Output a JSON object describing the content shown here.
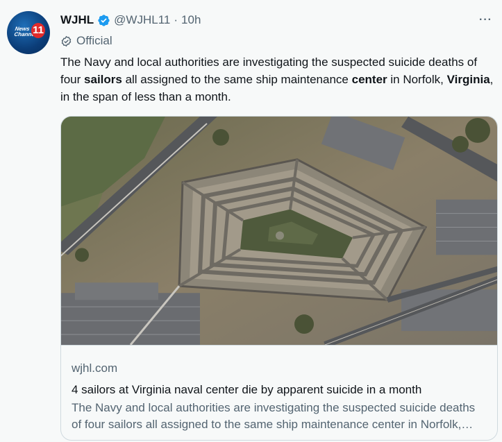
{
  "tweet": {
    "avatar_icon": "news-channel-11-logo",
    "avatar_text_small": "News Channel",
    "avatar_text_number": "11",
    "display_name": "WJHL",
    "handle": "@WJHL11",
    "separator": "·",
    "time": "10h",
    "verified_icon": "verified-badge-icon",
    "official_label": "Official",
    "official_icon": "checkmark-circle-icon",
    "more_icon": "more-horizontal-icon",
    "text_parts": {
      "p1": "The Navy and local authorities are investigating the suspected suicide deaths of four ",
      "b1": "sailors",
      "p2": " all assigned to the same ship maintenance ",
      "b2": "center",
      "p3": " in Norfolk, ",
      "b3": "Virginia",
      "p4": ", in the span of less than a month."
    }
  },
  "card": {
    "image_description": "pentagon-aerial-photo",
    "domain": "wjhl.com",
    "title": "4 sailors at Virginia naval center die by apparent suicide in a month",
    "description": "The Navy and local authorities are investigating the suspected suicide deaths of four sailors all assigned to the same ship maintenance center in Norfolk, Virginia, in the span of less than a month."
  },
  "colors": {
    "background": "#f7f9f9",
    "verified_blue": "#1d9bf0",
    "secondary_text": "#536471",
    "border": "#cfd9de"
  }
}
